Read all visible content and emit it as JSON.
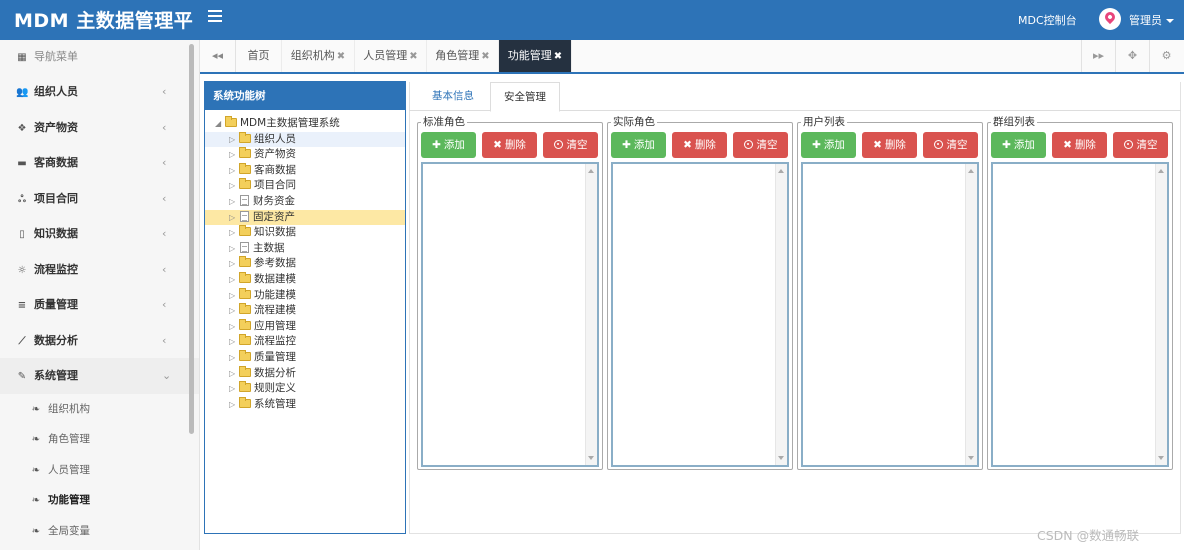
{
  "header": {
    "brand": "MDM 主数据管理平",
    "mdc_console": "MDC控制台",
    "user_name": "管理员",
    "accent_color": "#2d73b7"
  },
  "sidebar": {
    "title": "导航菜单",
    "items": [
      {
        "label": "组织人员",
        "icon": "users-icon"
      },
      {
        "label": "资产物资",
        "icon": "cubes-icon"
      },
      {
        "label": "客商数据",
        "icon": "briefcase-icon"
      },
      {
        "label": "项目合同",
        "icon": "sitemap-icon"
      },
      {
        "label": "知识数据",
        "icon": "file-icon"
      },
      {
        "label": "流程监控",
        "icon": "spinner-icon"
      },
      {
        "label": "质量管理",
        "icon": "list-icon"
      },
      {
        "label": "数据分析",
        "icon": "chart-icon"
      },
      {
        "label": "系统管理",
        "icon": "wrench-icon"
      }
    ],
    "sub_items": [
      {
        "label": "组织机构"
      },
      {
        "label": "角色管理"
      },
      {
        "label": "人员管理"
      },
      {
        "label": "功能管理"
      },
      {
        "label": "全局变量"
      }
    ]
  },
  "tabs": [
    {
      "label": "首页"
    },
    {
      "label": "组织机构"
    },
    {
      "label": "人员管理"
    },
    {
      "label": "角色管理"
    },
    {
      "label": "功能管理"
    }
  ],
  "tree_panel": {
    "title": "系统功能树",
    "root": "MDM主数据管理系统",
    "nodes": [
      {
        "label": "组织人员"
      },
      {
        "label": "资产物资"
      },
      {
        "label": "客商数据"
      },
      {
        "label": "项目合同"
      },
      {
        "label": "财务资金"
      },
      {
        "label": "固定资产"
      },
      {
        "label": "知识数据"
      },
      {
        "label": "主数据"
      },
      {
        "label": "参考数据"
      },
      {
        "label": "数据建模"
      },
      {
        "label": "功能建模"
      },
      {
        "label": "流程建模"
      },
      {
        "label": "应用管理"
      },
      {
        "label": "流程监控"
      },
      {
        "label": "质量管理"
      },
      {
        "label": "数据分析"
      },
      {
        "label": "规则定义"
      },
      {
        "label": "系统管理"
      }
    ]
  },
  "content": {
    "tabs": [
      {
        "label": "基本信息"
      },
      {
        "label": "安全管理"
      }
    ],
    "groups": [
      {
        "legend": "标准角色"
      },
      {
        "legend": "实际角色"
      },
      {
        "legend": "用户列表"
      },
      {
        "legend": "群组列表"
      }
    ],
    "buttons": {
      "add": "添加",
      "delete": "删除",
      "clear": "清空"
    }
  },
  "watermark": "CSDN @数通畅联"
}
